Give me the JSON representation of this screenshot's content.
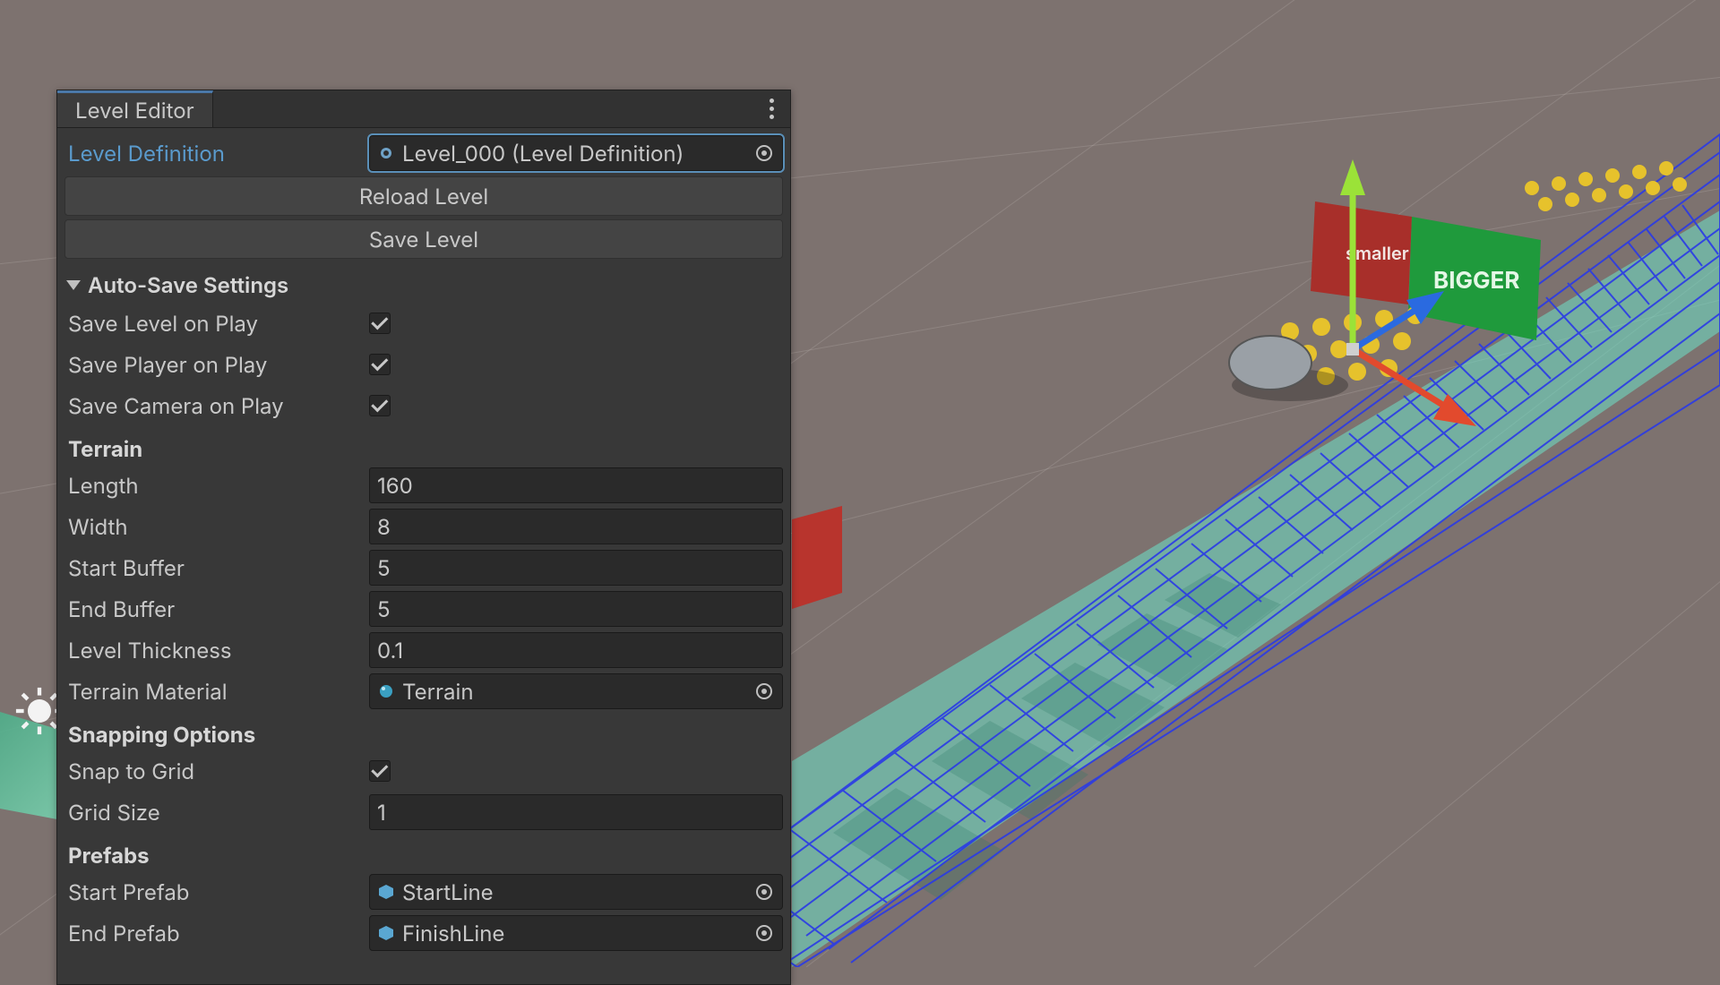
{
  "panel": {
    "tab_title": "Level Editor",
    "level_def_label": "Level Definition",
    "level_def_value": "Level_000 (Level Definition)",
    "reload_btn": "Reload Level",
    "save_btn": "Save Level",
    "autosave_heading": "Auto-Save Settings",
    "autosave": [
      {
        "label": "Save Level on Play",
        "checked": true
      },
      {
        "label": "Save Player on Play",
        "checked": true
      },
      {
        "label": "Save Camera on Play",
        "checked": true
      }
    ],
    "terrain_heading": "Terrain",
    "terrain": {
      "length_label": "Length",
      "length": "160",
      "width_label": "Width",
      "width": "8",
      "start_label": "Start Buffer",
      "start": "5",
      "end_label": "End Buffer",
      "end": "5",
      "thick_label": "Level Thickness",
      "thick": "0.1",
      "mat_label": "Terrain Material",
      "mat": "Terrain"
    },
    "snap_heading": "Snapping Options",
    "snap": {
      "grid_label": "Snap to Grid",
      "grid": true,
      "size_label": "Grid Size",
      "size": "1"
    },
    "prefab_heading": "Prefabs",
    "prefab": {
      "start_label": "Start Prefab",
      "start": "StartLine",
      "end_label": "End Prefab",
      "end": "FinishLine"
    }
  },
  "scene": {
    "gate_left": "smaller",
    "gate_right": "BIGGER"
  }
}
